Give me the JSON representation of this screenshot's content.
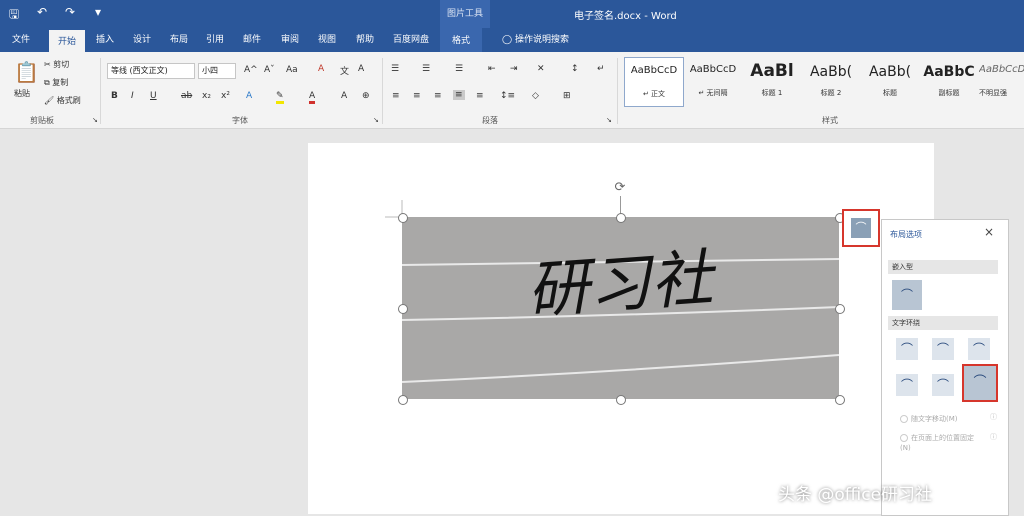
{
  "window": {
    "title": "电子签名.docx - Word",
    "context_tool": "图片工具",
    "accent": "#2b579a",
    "highlight": "#d6362c"
  },
  "qat": {
    "save": "save-icon",
    "undo": "undo-icon",
    "redo": "redo-icon",
    "more": "▾"
  },
  "tabs": [
    "文件",
    "开始",
    "插入",
    "设计",
    "布局",
    "引用",
    "邮件",
    "审阅",
    "视图",
    "帮助",
    "百度网盘",
    "格式",
    "操作说明搜索"
  ],
  "ribbon": {
    "clipboard": {
      "paste": "粘贴",
      "cut": "剪切",
      "copy": "复制",
      "format_painter": "格式刷",
      "label": "剪贴板"
    },
    "font": {
      "name": "等线 (西文正文)",
      "size": "小四",
      "label": "字体"
    },
    "paragraph": {
      "label": "段落"
    },
    "styles": {
      "label": "样式",
      "items": [
        {
          "sample": "AaBbCcD",
          "name": "正文"
        },
        {
          "sample": "AaBbCcD",
          "name": "无间隔"
        },
        {
          "sample": "AaBl",
          "name": "标题 1"
        },
        {
          "sample": "AaBb(",
          "name": "标题 2"
        },
        {
          "sample": "AaBb(",
          "name": "标题"
        },
        {
          "sample": "AaBbC",
          "name": "副标题"
        },
        {
          "sample": "AaBbCcD",
          "name": "不明显强"
        }
      ]
    }
  },
  "image": {
    "signature_text": "研习社"
  },
  "layout_panel": {
    "title": "布局选项",
    "close": "×",
    "inline_section": "嵌入型",
    "wrap_section": "文字环绕",
    "move_with_text": "随文字移动(M)",
    "fix_position": "在页面上的位置固定(N)"
  },
  "watermark": "头条 @office研习社"
}
